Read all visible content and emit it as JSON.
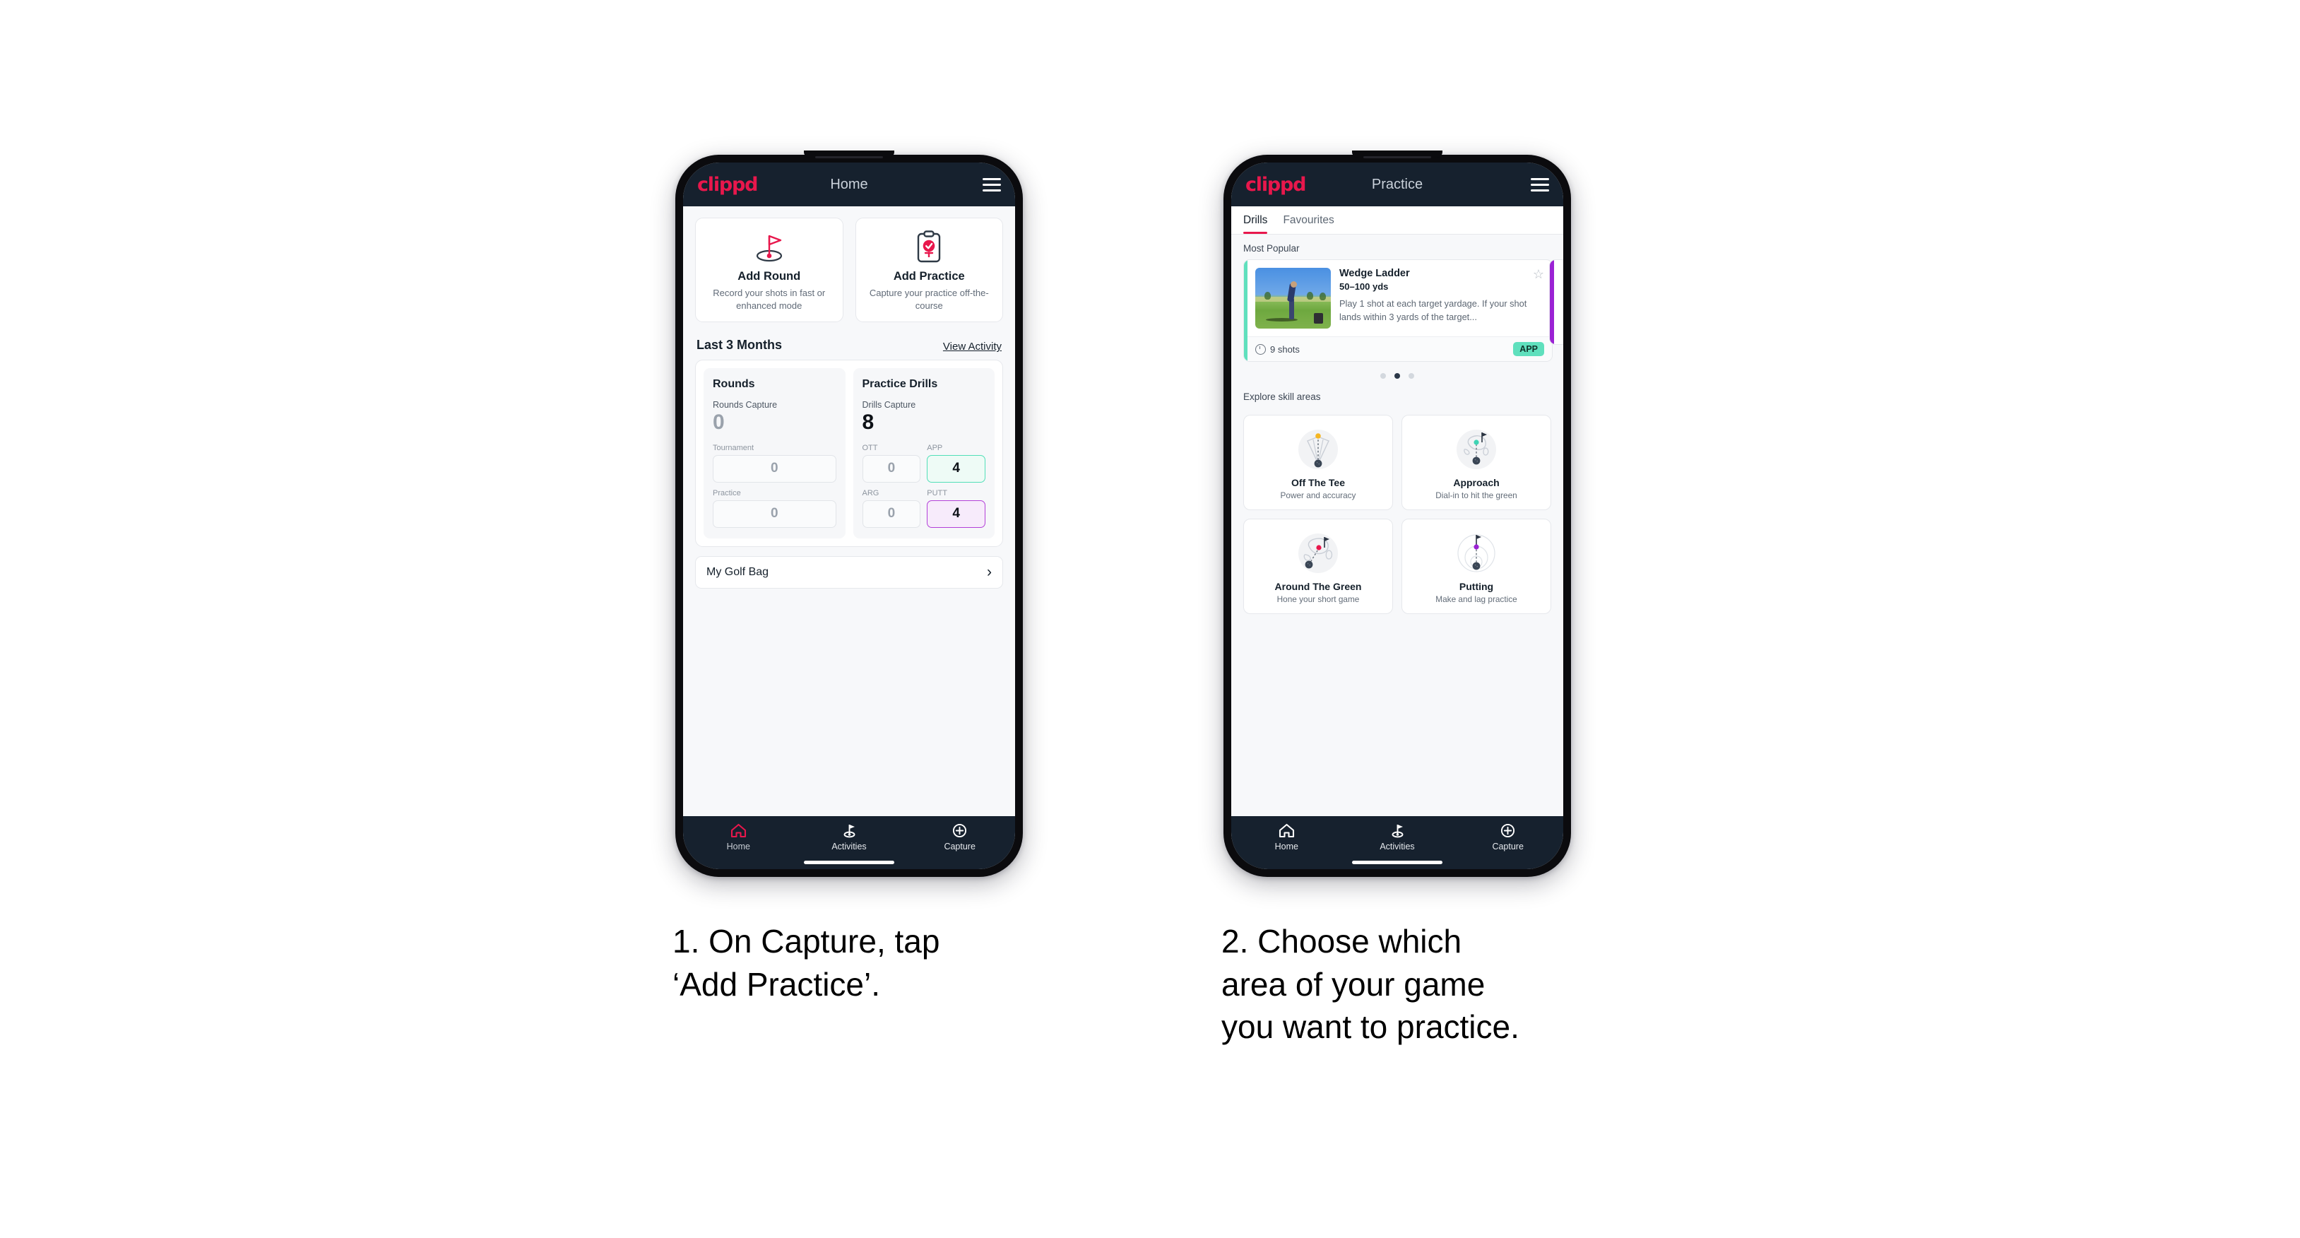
{
  "brand": {
    "logo_text": "clippd",
    "accent_pink": "#e8174c",
    "header_bg": "#16212e",
    "mint": "#5fe0bd",
    "purple": "#b340d8"
  },
  "phone1": {
    "header": {
      "title": "Home",
      "logo": "clippd",
      "menu_icon": "hamburger-icon"
    },
    "actions": [
      {
        "icon": "golf-flag-icon",
        "title": "Add Round",
        "subtitle": "Record your shots in fast or enhanced mode"
      },
      {
        "icon": "clipboard-check-icon",
        "title": "Add Practice",
        "subtitle": "Capture your practice off-the-course"
      }
    ],
    "section": {
      "title": "Last 3 Months",
      "link": "View Activity"
    },
    "stats": {
      "rounds": {
        "title": "Rounds",
        "capture_label": "Rounds Capture",
        "capture_value": "0",
        "items": [
          {
            "label": "Tournament",
            "value": "0",
            "style": "zero"
          },
          {
            "label": "Practice",
            "value": "0",
            "style": "zero"
          }
        ]
      },
      "drills": {
        "title": "Practice Drills",
        "capture_label": "Drills Capture",
        "capture_value": "8",
        "items": [
          {
            "label": "OTT",
            "value": "0",
            "style": "zero"
          },
          {
            "label": "APP",
            "value": "4",
            "style": "app"
          },
          {
            "label": "ARG",
            "value": "0",
            "style": "zero"
          },
          {
            "label": "PUTT",
            "value": "4",
            "style": "putt"
          }
        ]
      }
    },
    "golf_bag": {
      "label": "My Golf Bag",
      "chevron": "chevron-right-icon"
    },
    "nav": [
      {
        "label": "Home",
        "icon": "home-icon",
        "active": true
      },
      {
        "label": "Activities",
        "icon": "golf-flag-icon",
        "active": false
      },
      {
        "label": "Capture",
        "icon": "plus-circle-icon",
        "active": false
      }
    ]
  },
  "phone2": {
    "header": {
      "title": "Practice",
      "logo": "clippd",
      "menu_icon": "hamburger-icon"
    },
    "tabs": [
      {
        "label": "Drills",
        "active": true
      },
      {
        "label": "Favourites",
        "active": false
      }
    ],
    "most_popular_label": "Most Popular",
    "drill": {
      "title": "Wedge Ladder",
      "yardage": "50–100 yds",
      "description": "Play 1 shot at each target yardage. If your shot lands within 3 yards of the target...",
      "shots": "9 shots",
      "badge": "APP",
      "star_icon": "star-outline-icon",
      "clock_icon": "clock-icon",
      "accent_color": "#5fe0bd",
      "next_card_accent": "#9b22d4",
      "thumbnail": "golfer-on-course-photo"
    },
    "carousel_dots": {
      "count": 3,
      "active_index": 1
    },
    "explore_label": "Explore skill areas",
    "skills": [
      {
        "title": "Off The Tee",
        "subtitle": "Power and accuracy",
        "icon": "tee-dispersion-icon",
        "dot_color": "#f5b622"
      },
      {
        "title": "Approach",
        "subtitle": "Dial-in to hit the green",
        "icon": "approach-green-icon",
        "dot_color": "#3fd4b4"
      },
      {
        "title": "Around The Green",
        "subtitle": "Hone your short game",
        "icon": "chip-green-icon",
        "dot_color": "#e8174c"
      },
      {
        "title": "Putting",
        "subtitle": "Make and lag practice",
        "icon": "putting-rings-icon",
        "dot_color": "#9b22d4"
      }
    ],
    "nav": [
      {
        "label": "Home",
        "icon": "home-icon",
        "active": false
      },
      {
        "label": "Activities",
        "icon": "golf-flag-icon",
        "active": false
      },
      {
        "label": "Capture",
        "icon": "plus-circle-icon",
        "active": false
      }
    ]
  },
  "captions": [
    "1. On Capture, tap\n‘Add Practice’.",
    "2. Choose which\narea of your game\nyou want to practice."
  ]
}
